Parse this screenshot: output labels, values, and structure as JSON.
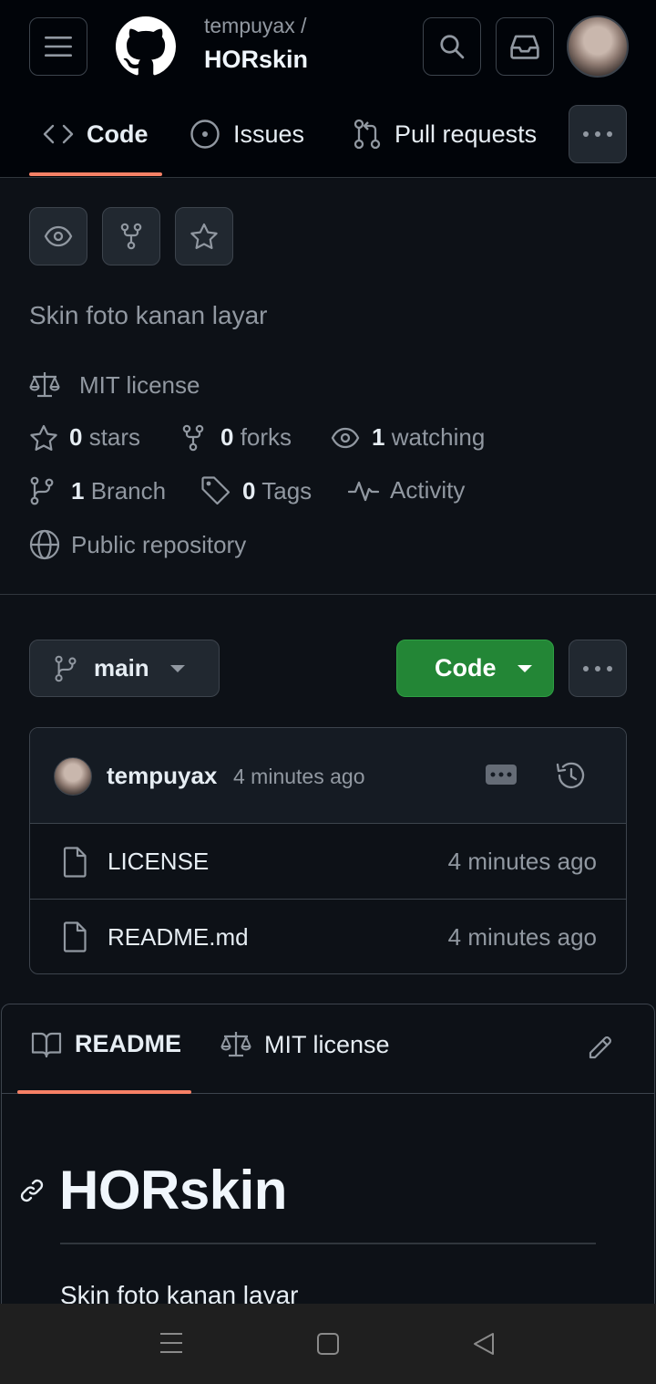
{
  "header": {
    "owner": "tempuyax /",
    "repo": "HORskin"
  },
  "tabs": [
    {
      "label": "Code"
    },
    {
      "label": "Issues"
    },
    {
      "label": "Pull requests"
    }
  ],
  "repo_info": {
    "description": "Skin foto kanan layar",
    "license": "MIT license",
    "stars_count": "0",
    "stars_label": "stars",
    "forks_count": "0",
    "forks_label": "forks",
    "watching_count": "1",
    "watching_label": "watching",
    "branch_count": "1",
    "branch_label": "Branch",
    "tags_count": "0",
    "tags_label": "Tags",
    "activity_label": "Activity",
    "visibility": "Public repository"
  },
  "branch": {
    "name": "main",
    "code_button": "Code"
  },
  "latest_commit": {
    "user": "tempuyax",
    "time": "4 minutes ago"
  },
  "files": [
    {
      "name": "LICENSE",
      "time": "4 minutes ago"
    },
    {
      "name": "README.md",
      "time": "4 minutes ago"
    }
  ],
  "readme": {
    "tab_readme": "README",
    "tab_license": "MIT license",
    "heading": "HORskin",
    "paragraph": "Skin foto kanan layar"
  },
  "colors": {
    "accent_underline": "#f78166",
    "code_button": "#238636",
    "background": "#0d1117"
  }
}
